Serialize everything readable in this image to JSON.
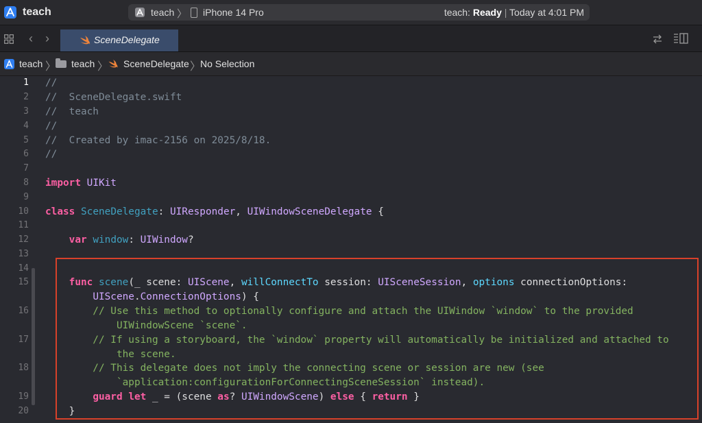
{
  "titlebar": {
    "app_name": "teach",
    "scheme": "teach",
    "scheme_separator": "〉",
    "device": "iPhone 14 Pro",
    "status_prefix": "teach: ",
    "status_state": "Ready",
    "status_separator": " | ",
    "status_time": "Today at 4:01 PM"
  },
  "tabbar": {
    "active_tab": "SceneDelegate",
    "nav_back": "‹",
    "nav_forward": "›"
  },
  "jumpbar": {
    "items": [
      "teach",
      "teach",
      "SceneDelegate",
      "No Selection"
    ],
    "separator": "〉"
  },
  "editor": {
    "current_line": 1,
    "lines": [
      {
        "n": "1",
        "code": "//"
      },
      {
        "n": "2",
        "code": "//  SceneDelegate.swift"
      },
      {
        "n": "3",
        "code": "//  teach"
      },
      {
        "n": "4",
        "code": "//"
      },
      {
        "n": "5",
        "code": "//  Created by imac-2156 on 2025/8/18."
      },
      {
        "n": "6",
        "code": "//"
      },
      {
        "n": "7",
        "code": ""
      },
      {
        "n": "8",
        "code": "import UIKit"
      },
      {
        "n": "9",
        "code": ""
      },
      {
        "n": "10",
        "code": "class SceneDelegate: UIResponder, UIWindowSceneDelegate {"
      },
      {
        "n": "11",
        "code": ""
      },
      {
        "n": "12",
        "code": "    var window: UIWindow?"
      },
      {
        "n": "13",
        "code": ""
      },
      {
        "n": "14",
        "code": ""
      },
      {
        "n": "15",
        "code": "    func scene(_ scene: UIScene, willConnectTo session: UISceneSession, options connectionOptions:"
      },
      {
        "n": "",
        "code": "        UIScene.ConnectionOptions) {"
      },
      {
        "n": "16",
        "code": "        // Use this method to optionally configure and attach the UIWindow `window` to the provided"
      },
      {
        "n": "",
        "code": "            UIWindowScene `scene`."
      },
      {
        "n": "17",
        "code": "        // If using a storyboard, the `window` property will automatically be initialized and attached to"
      },
      {
        "n": "",
        "code": "            the scene."
      },
      {
        "n": "18",
        "code": "        // This delegate does not imply the connecting scene or session are new (see"
      },
      {
        "n": "",
        "code": "            `application:configurationForConnectingSceneSession` instead)."
      },
      {
        "n": "19",
        "code": "        guard let _ = (scene as? UIWindowScene) else { return }"
      },
      {
        "n": "20",
        "code": "    }"
      }
    ]
  },
  "colors": {
    "highlight_border": "#d8412a",
    "keyword": "#fc5fa3",
    "comment": "#7f8c98",
    "doc_comment": "#84b360",
    "type": "#d0a8ff",
    "declaration": "#41a1c0"
  }
}
